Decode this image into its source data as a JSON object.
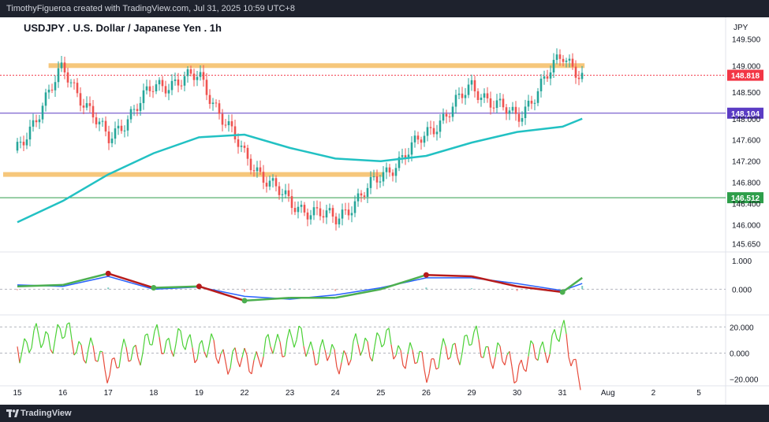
{
  "header": {
    "attribution": "TimothyFigueroa created with TradingView.com, Jul 31, 2025 10:59 UTC+8"
  },
  "footer": {
    "brand": "TradingView"
  },
  "colors": {
    "background": "#ffffff",
    "frame": "#1e222d",
    "ma_line": "#22c1c3",
    "zone": "#f6c77b",
    "candle_up": "#26a69a",
    "candle_down": "#ef5350",
    "last_price": "#f23645",
    "purple_level": "#5b3cc4",
    "green_level": "#2e9e4a",
    "osc_green": "#4caf50",
    "osc_red": "#b71c1c",
    "osc_blue": "#2962ff",
    "rsi_green": "#4cd137",
    "rsi_red": "#e74c3c"
  },
  "chart_data": {
    "type": "line",
    "title": "USDJPY . U.S. Dollar / Japanese Yen . 1h",
    "currency": "JPY",
    "x_ticks": [
      "15",
      "16",
      "17",
      "18",
      "19",
      "22",
      "23",
      "24",
      "25",
      "26",
      "29",
      "30",
      "31",
      "Aug",
      "2",
      "5"
    ],
    "price_ticks": [
      "149.500",
      "149.000",
      "148.500",
      "148.000",
      "147.600",
      "147.200",
      "146.800",
      "146.400",
      "146.000",
      "145.650"
    ],
    "price_ylim": [
      145.55,
      149.85
    ],
    "price_series": [
      {
        "name": "close",
        "x": [
          "15",
          "16",
          "17",
          "18",
          "19",
          "22",
          "23",
          "24",
          "25",
          "26",
          "29",
          "30",
          "31",
          "31 late"
        ],
        "values": [
          147.4,
          148.95,
          147.6,
          148.6,
          148.8,
          147.3,
          146.4,
          146.1,
          146.9,
          147.7,
          148.6,
          148.0,
          149.2,
          148.818
        ]
      },
      {
        "name": "moving average",
        "x": [
          "15",
          "16",
          "17",
          "18",
          "19",
          "22",
          "23",
          "24",
          "25",
          "26",
          "29",
          "30",
          "31",
          "31 late"
        ],
        "values": [
          146.05,
          146.45,
          146.95,
          147.35,
          147.65,
          147.7,
          147.45,
          147.25,
          147.2,
          147.3,
          147.55,
          147.75,
          147.85,
          148.0
        ]
      }
    ],
    "horizontal_levels": [
      {
        "value": 148.818,
        "label": "148.818",
        "role": "last price"
      },
      {
        "value": 148.104,
        "label": "148.104",
        "role": "purple level"
      },
      {
        "value": 146.512,
        "label": "146.512",
        "role": "green level"
      }
    ],
    "zones": [
      {
        "from": "16",
        "to": "31 late",
        "value": 149.0
      },
      {
        "from": "15",
        "to": "25",
        "value": 146.95
      }
    ],
    "oscillator": {
      "ticks": [
        "1.000",
        "0.000"
      ],
      "ylim": [
        -0.9,
        1.25
      ],
      "x": [
        "15",
        "16",
        "17",
        "18",
        "19",
        "22",
        "23",
        "24",
        "25",
        "26",
        "29",
        "30",
        "31",
        "31 late"
      ],
      "fast": [
        0.1,
        0.15,
        0.55,
        0.05,
        0.1,
        -0.4,
        -0.3,
        -0.3,
        0.0,
        0.5,
        0.45,
        0.1,
        -0.1,
        0.4
      ],
      "slow": [
        0.15,
        0.1,
        0.45,
        0.0,
        0.08,
        -0.25,
        -0.35,
        -0.2,
        0.05,
        0.4,
        0.4,
        0.2,
        -0.05,
        0.2
      ]
    },
    "rsi": {
      "ticks": [
        "20.000",
        "0.000",
        "−20.000"
      ],
      "ylim": [
        -25,
        28
      ],
      "x": [
        "15",
        "16",
        "17",
        "18",
        "19",
        "22",
        "23",
        "24",
        "25",
        "26",
        "29",
        "30",
        "31",
        "31 late"
      ],
      "values": [
        5,
        15,
        -10,
        10,
        5,
        -8,
        12,
        -5,
        10,
        -10,
        10,
        -12,
        15,
        -20
      ]
    }
  }
}
